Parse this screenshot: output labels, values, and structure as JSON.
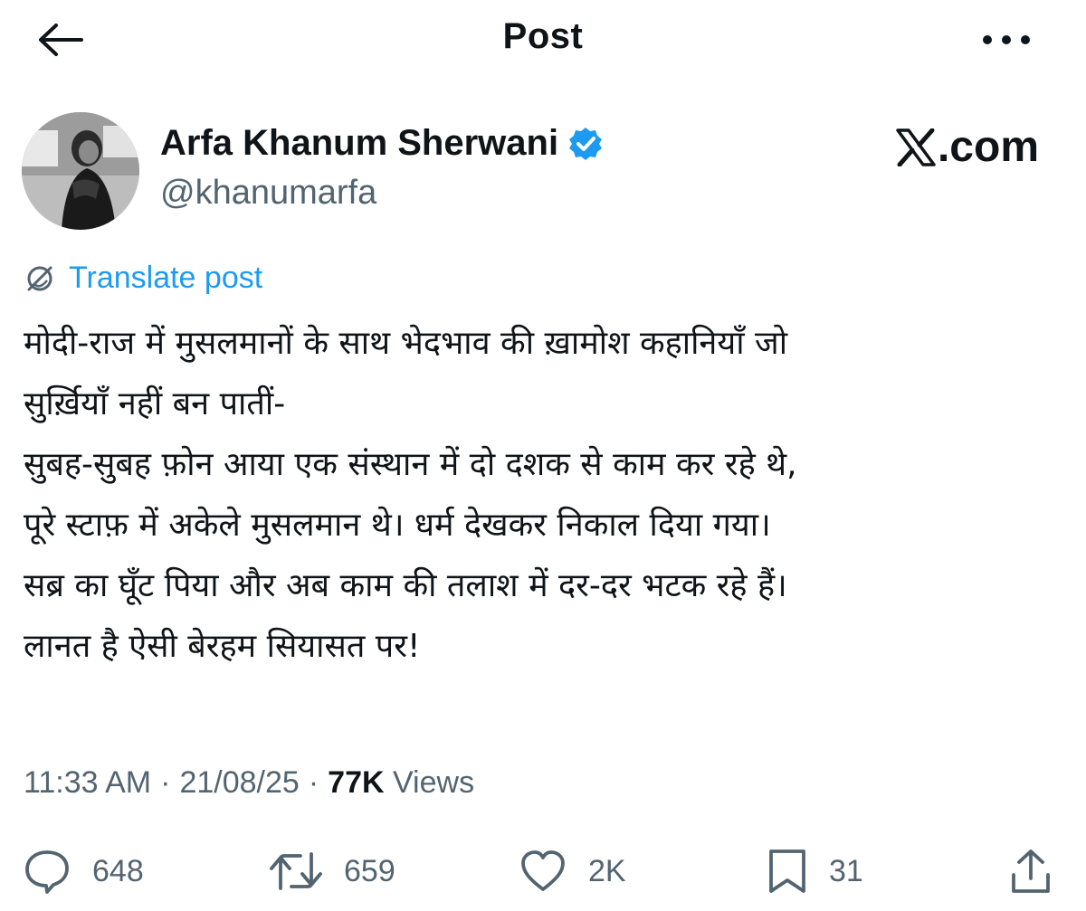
{
  "header": {
    "title": "Post",
    "back_icon": "arrow-left-icon",
    "more_icon": "more-horizontal-icon"
  },
  "author": {
    "name": "Arfa Khanum Sherwani",
    "handle": "@khanumarfa",
    "verified_icon": "verified-badge-icon",
    "verified_color": "#1d9bf0"
  },
  "watermark": {
    "text": ".com",
    "logo_icon": "x-logo-icon"
  },
  "translate": {
    "label": "Translate post",
    "icon": "globe-icon"
  },
  "post": {
    "lines": [
      "मोदी-राज में मुसलमानों के साथ भेदभाव की ख़ामोश कहानियाँ जो",
      "सुर्ख़ियाँ नहीं बन पातीं-",
      "सुबह-सुबह फ़ोन आया एक संस्थान में दो दशक से काम कर रहे थे,",
      "पूरे स्टाफ़ में अकेले मुसलमान थे। धर्म देखकर निकाल दिया गया।",
      "सब्र का घूँट पिया और अब काम की तलाश में दर-दर भटक रहे हैं।",
      "लानत है ऐसी बेरहम सियासत पर!"
    ]
  },
  "meta": {
    "time": "11:33 AM",
    "date": "21/08/25",
    "views_count": "77K",
    "views_label": "Views",
    "separator": "·"
  },
  "actions": {
    "replies": "648",
    "reposts": "659",
    "likes": "2K",
    "bookmarks": "31"
  },
  "colors": {
    "accent": "#1d9bf0",
    "text": "#0f1419",
    "muted": "#536471"
  }
}
